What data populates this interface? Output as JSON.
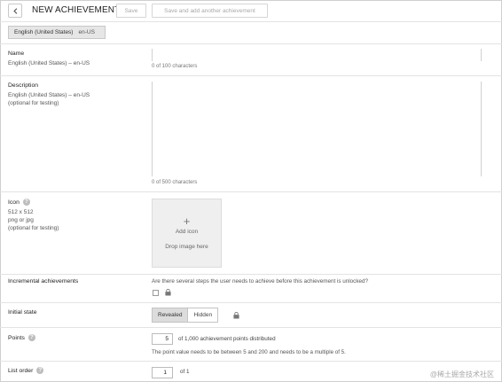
{
  "header": {
    "title": "NEW ACHIEVEMENT",
    "save_label": "Save",
    "save_add_label": "Save and add another achievement"
  },
  "language_tab": {
    "name": "English (United States)",
    "code": "en-US"
  },
  "name_field": {
    "label": "Name",
    "sublabel": "English (United States) – en-US",
    "counter": "0 of 100 characters"
  },
  "description_field": {
    "label": "Description",
    "sublabel_lang": "English (United States) – en-US",
    "sublabel_note": "(optional for testing)",
    "counter": "0 of 500 characters"
  },
  "icon_field": {
    "label": "Icon",
    "size": "512 x 512",
    "format": "png or jpg",
    "note": "(optional for testing)",
    "add_label": "Add icon",
    "drop_label": "Drop image here"
  },
  "incremental": {
    "label": "Incremental achievements",
    "question": "Are there several steps the user needs to achieve before this achievement is unlocked?"
  },
  "initial_state": {
    "label": "Initial state",
    "options": [
      "Revealed",
      "Hidden"
    ]
  },
  "points": {
    "label": "Points",
    "value": "5",
    "distributed": "of 1,000 achievement points distributed",
    "note": "The point value needs to be between 5 and 200 and needs to be a multiple of 5."
  },
  "list_order": {
    "label": "List order",
    "value": "1",
    "suffix": "of 1"
  },
  "watermark": "@稀土掘金技术社区",
  "colors": {
    "active_segment": "#dcdcdc",
    "border": "#d0d0d0",
    "help_icon": "#bdbdbd"
  }
}
